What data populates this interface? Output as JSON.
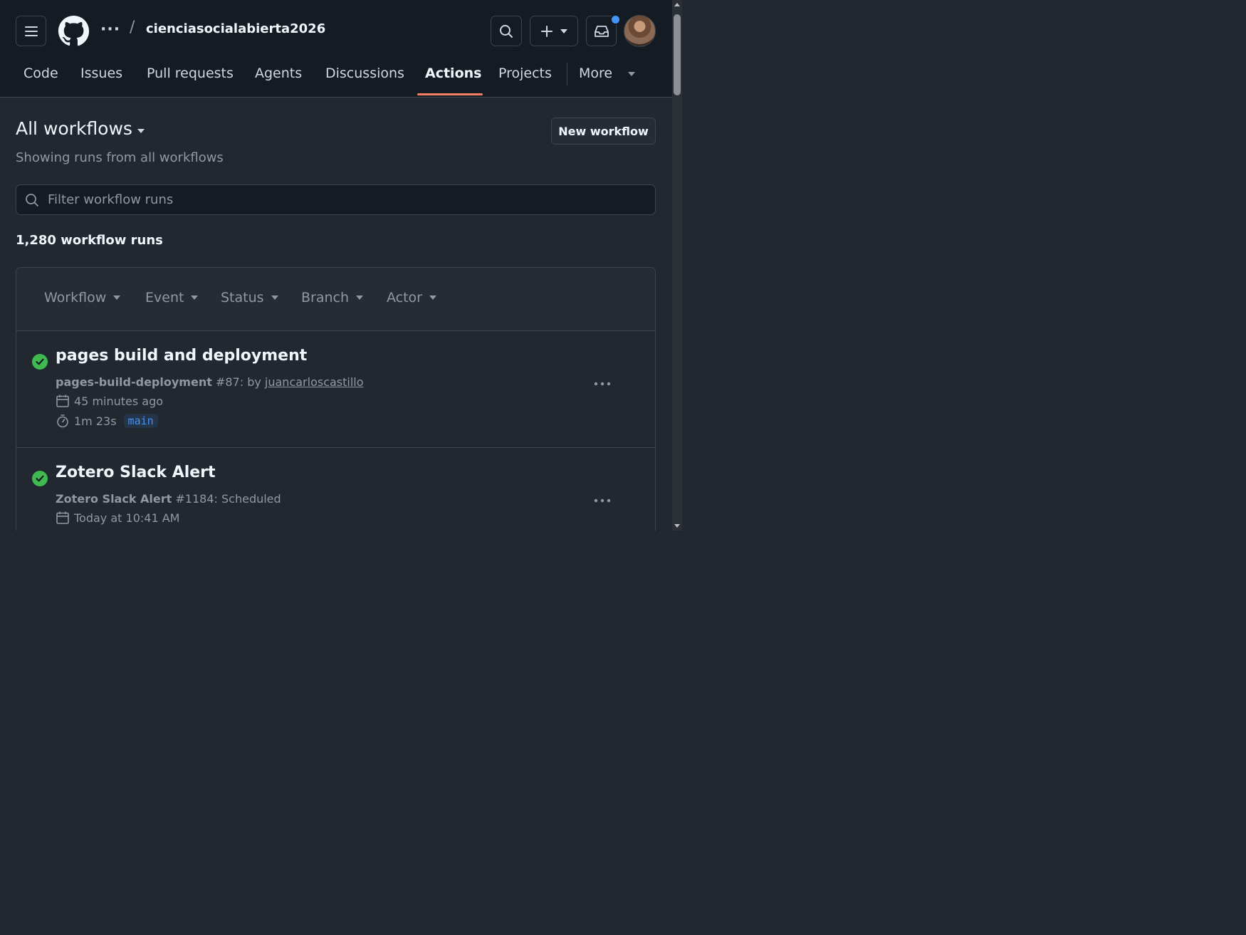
{
  "header": {
    "breadcrumb_dots": "···",
    "breadcrumb_sep": "/",
    "repo_name": "cienciasocialabierta2026"
  },
  "nav": {
    "items": [
      {
        "label": "Code"
      },
      {
        "label": "Issues"
      },
      {
        "label": "Pull requests"
      },
      {
        "label": "Agents"
      },
      {
        "label": "Discussions"
      },
      {
        "label": "Actions",
        "active": true
      },
      {
        "label": "Projects"
      },
      {
        "label": "More"
      }
    ]
  },
  "main": {
    "title": "All workflows",
    "subtitle": "Showing runs from all workflows",
    "new_workflow_label": "New workflow",
    "filter_placeholder": "Filter workflow runs",
    "runs_count": "1,280 workflow runs",
    "filters": [
      "Workflow",
      "Event",
      "Status",
      "Branch",
      "Actor"
    ]
  },
  "runs": [
    {
      "title": "pages build and deployment",
      "workflow": "pages-build-deployment",
      "run_info": " #87: by ",
      "actor": "juancarloscastillo",
      "time": "45 minutes ago",
      "duration": "1m 23s",
      "branch": "main",
      "status": "success"
    },
    {
      "title": "Zotero Slack Alert",
      "workflow": "Zotero Slack Alert",
      "run_info": " #1184: Scheduled",
      "time": "Today at 10:41 AM",
      "status": "success"
    }
  ],
  "colors": {
    "success": "#3fb950",
    "accent_underline": "#f78166",
    "notification": "#4493f8",
    "background": "#212830",
    "header_bg": "#151b23"
  }
}
